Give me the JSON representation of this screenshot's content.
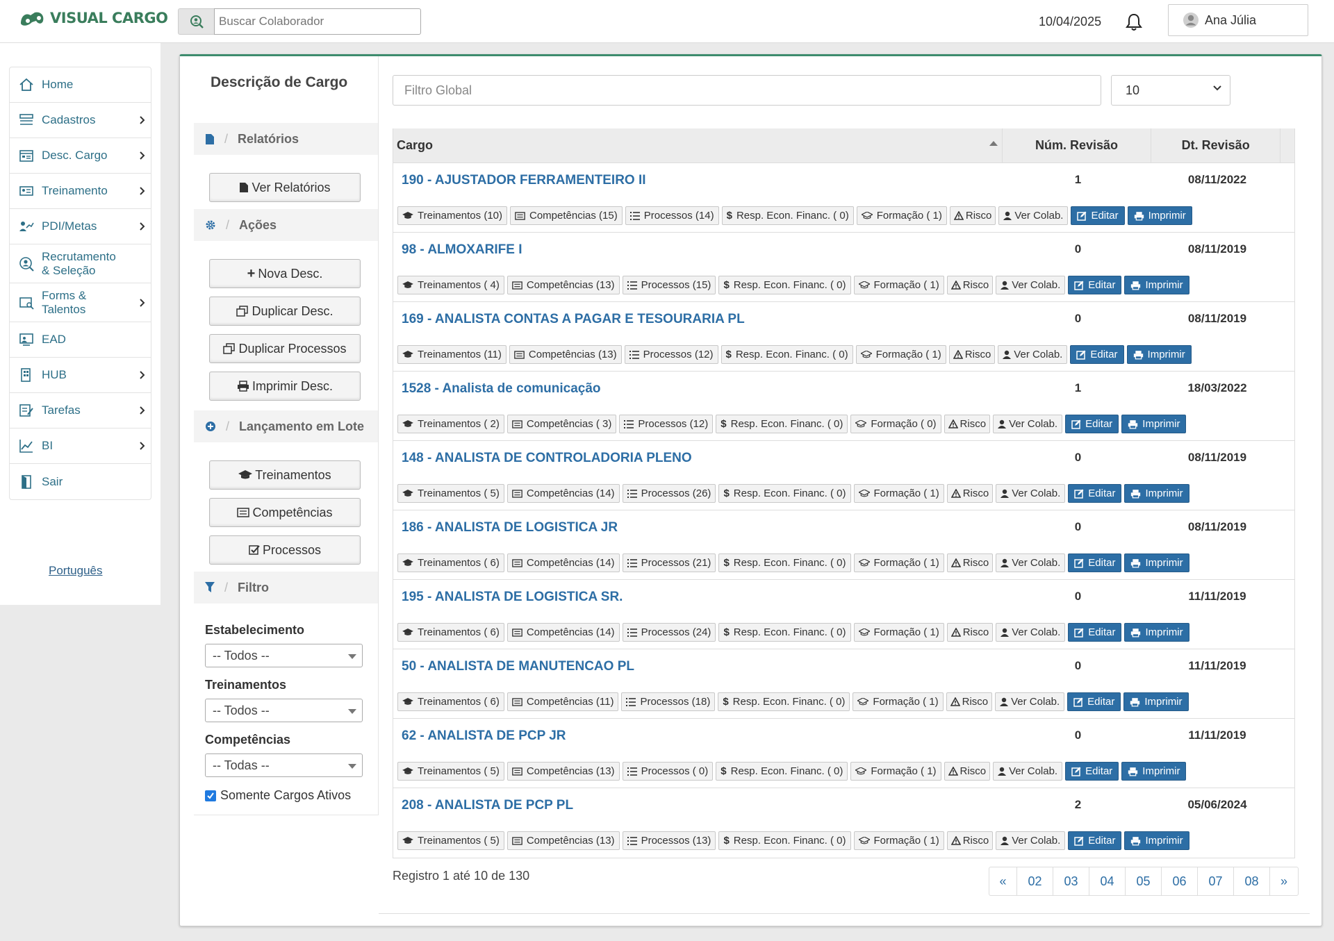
{
  "app": {
    "logo_text": "VISUAL CARGO",
    "brand_color": "#3a7d5c",
    "accent_color": "#2d6ea5"
  },
  "topbar": {
    "search_placeholder": "Buscar Colaborador",
    "date": "10/04/2025",
    "user_name": "Ana Júlia"
  },
  "sidebar": {
    "items": [
      {
        "label": "Home",
        "icon": "home-icon",
        "has_submenu": false
      },
      {
        "label": "Cadastros",
        "icon": "list-icon",
        "has_submenu": true
      },
      {
        "label": "Desc. Cargo",
        "icon": "calendar-icon",
        "has_submenu": true
      },
      {
        "label": "Treinamento",
        "icon": "id-card-icon",
        "has_submenu": true
      },
      {
        "label": "PDI/Metas",
        "icon": "growth-icon",
        "has_submenu": true
      },
      {
        "label": "Recrutamento & Seleção",
        "line1": "Recrutamento",
        "line2": "& Seleção",
        "icon": "user-search-icon",
        "has_submenu": false
      },
      {
        "label": "Forms & Talentos",
        "line1": "Forms &",
        "line2": "Talentos",
        "icon": "form-search-icon",
        "has_submenu": true
      },
      {
        "label": "EAD",
        "icon": "ead-icon",
        "has_submenu": false
      },
      {
        "label": "HUB",
        "icon": "hub-icon",
        "has_submenu": true
      },
      {
        "label": "Tarefas",
        "icon": "tasks-icon",
        "has_submenu": true
      },
      {
        "label": "BI",
        "icon": "chart-icon",
        "has_submenu": true
      },
      {
        "label": "Sair",
        "icon": "exit-icon",
        "has_submenu": false
      }
    ],
    "language_link": "Português"
  },
  "left_panel": {
    "title": "Descrição de Cargo",
    "sections": {
      "relatorios": "Relatórios",
      "acoes": "Ações",
      "lote": "Lançamento em Lote",
      "filtro": "Filtro"
    },
    "buttons": {
      "ver_relatorios": "Ver Relatórios",
      "nova_desc": "Nova Desc.",
      "duplicar_desc": "Duplicar Desc.",
      "duplicar_processos": "Duplicar Processos",
      "imprimir_desc": "Imprimir Desc.",
      "treinamentos": "Treinamentos",
      "competencias": "Competências",
      "processos": "Processos"
    },
    "filters": {
      "estabelecimento_label": "Estabelecimento",
      "estabelecimento_value": "-- Todos --",
      "treinamentos_label": "Treinamentos",
      "treinamentos_value": "-- Todos --",
      "competencias_label": "Competências",
      "competencias_value": "-- Todas --",
      "somente_ativos_label": "Somente Cargos Ativos",
      "somente_ativos_checked": true
    }
  },
  "main": {
    "global_filter_placeholder": "Filtro Global",
    "page_size": "10",
    "columns": [
      "Cargo",
      "Núm. Revisão",
      "Dt. Revisão"
    ],
    "rows": [
      {
        "title": "190 - AJUSTADOR FERRAMENTEIRO II",
        "rev": "1",
        "date": "08/11/2022",
        "trein": "Treinamentos (10)",
        "comp": "Competências (15)",
        "proc": "Processos  (14)",
        "resp": "Resp. Econ. Financ. ( 0)",
        "form": "Formação ( 1)"
      },
      {
        "title": "98 - ALMOXARIFE I",
        "rev": "0",
        "date": "08/11/2019",
        "trein": "Treinamentos ( 4)",
        "comp": "Competências (13)",
        "proc": "Processos  (15)",
        "resp": "Resp. Econ. Financ. ( 0)",
        "form": "Formação ( 1)"
      },
      {
        "title": "169 - ANALISTA CONTAS A PAGAR E TESOURARIA PL",
        "rev": "0",
        "date": "08/11/2019",
        "trein": "Treinamentos (11)",
        "comp": "Competências (13)",
        "proc": "Processos  (12)",
        "resp": "Resp. Econ. Financ. ( 0)",
        "form": "Formação ( 1)"
      },
      {
        "title": "1528 - Analista de comunicação",
        "rev": "1",
        "date": "18/03/2022",
        "trein": "Treinamentos ( 2)",
        "comp": "Competências ( 3)",
        "proc": "Processos  (12)",
        "resp": "Resp. Econ. Financ. ( 0)",
        "form": "Formação ( 0)"
      },
      {
        "title": "148 - ANALISTA DE CONTROLADORIA PLENO",
        "rev": "0",
        "date": "08/11/2019",
        "trein": "Treinamentos ( 5)",
        "comp": "Competências (14)",
        "proc": "Processos  (26)",
        "resp": "Resp. Econ. Financ. ( 0)",
        "form": "Formação ( 1)"
      },
      {
        "title": "186 - ANALISTA DE LOGISTICA JR",
        "rev": "0",
        "date": "08/11/2019",
        "trein": "Treinamentos ( 6)",
        "comp": "Competências (14)",
        "proc": "Processos  (21)",
        "resp": "Resp. Econ. Financ. ( 0)",
        "form": "Formação ( 1)"
      },
      {
        "title": "195 - ANALISTA DE LOGISTICA SR.",
        "rev": "0",
        "date": "11/11/2019",
        "trein": "Treinamentos ( 6)",
        "comp": "Competências (14)",
        "proc": "Processos  (24)",
        "resp": "Resp. Econ. Financ. ( 0)",
        "form": "Formação ( 1)"
      },
      {
        "title": "50 - ANALISTA DE MANUTENCAO PL",
        "rev": "0",
        "date": "11/11/2019",
        "trein": "Treinamentos ( 6)",
        "comp": "Competências (11)",
        "proc": "Processos  (18)",
        "resp": "Resp. Econ. Financ. ( 0)",
        "form": "Formação ( 1)"
      },
      {
        "title": "62 - ANALISTA DE PCP JR",
        "rev": "0",
        "date": "11/11/2019",
        "trein": "Treinamentos ( 5)",
        "comp": "Competências (13)",
        "proc": "Processos  ( 0)",
        "resp": "Resp. Econ. Financ. ( 0)",
        "form": "Formação ( 1)"
      },
      {
        "title": "208 - ANALISTA DE PCP PL",
        "rev": "2",
        "date": "05/06/2024",
        "trein": "Treinamentos ( 5)",
        "comp": "Competências (13)",
        "proc": "Processos  (13)",
        "resp": "Resp. Econ. Financ. ( 0)",
        "form": "Formação ( 1)"
      }
    ],
    "row_actions": {
      "risco": "Risco",
      "ver_colab": "Ver Colab.",
      "editar": "Editar",
      "imprimir": "Imprimir"
    },
    "footer_text": "Registro 1 até 10 de 130",
    "pager": [
      "«",
      "02",
      "03",
      "04",
      "05",
      "06",
      "07",
      "08",
      "»"
    ]
  }
}
